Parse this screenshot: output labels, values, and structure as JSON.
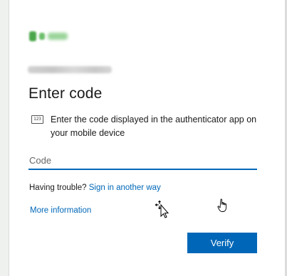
{
  "org": {
    "name": ""
  },
  "account": {
    "email": ""
  },
  "title": "Enter code",
  "instruction": {
    "icon": "keypad-icon",
    "icon_text": "123",
    "text": "Enter the code displayed in the authenticator app on your mobile device"
  },
  "code_input": {
    "placeholder": "Code",
    "value": ""
  },
  "trouble": {
    "prefix": "Having trouble?",
    "link": "Sign in another way"
  },
  "more_info": "More information",
  "verify_label": "Verify",
  "colors": {
    "accent": "#0067b8",
    "text": "#1b1b1b"
  }
}
